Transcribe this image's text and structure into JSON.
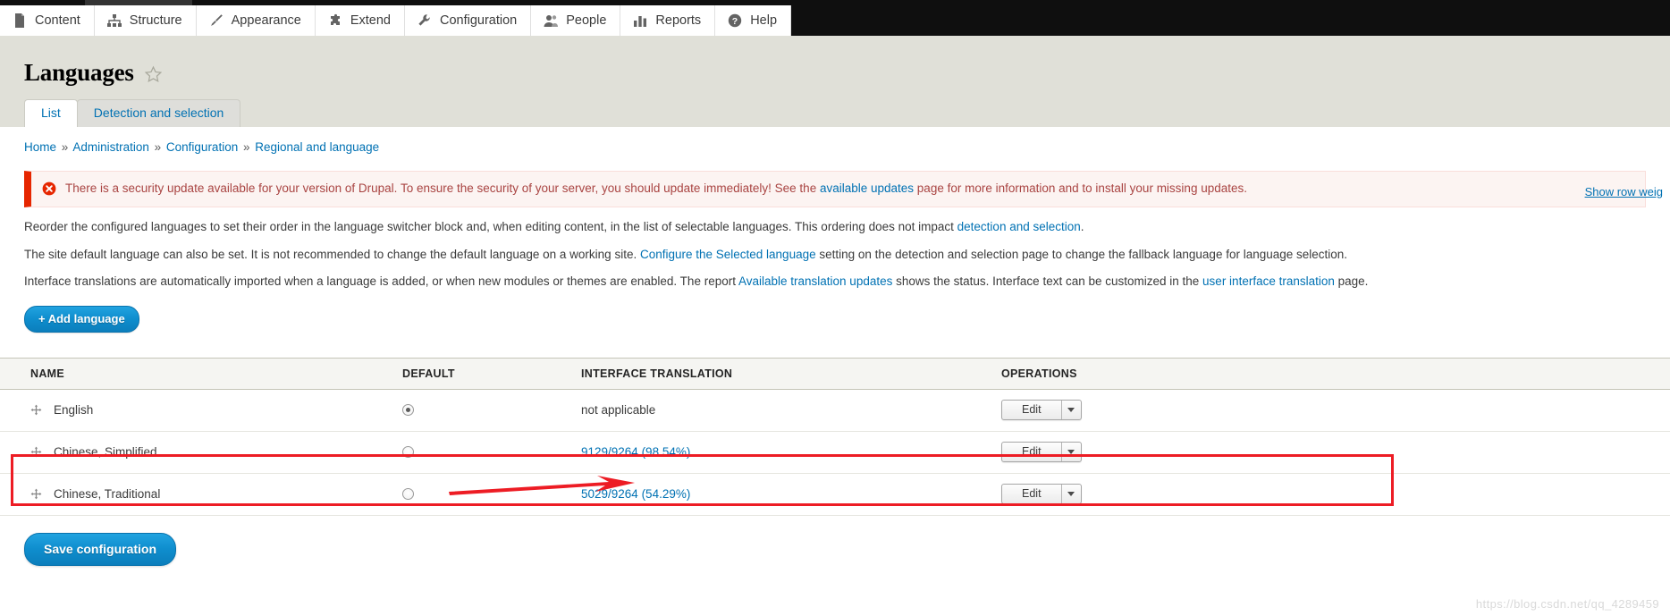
{
  "toolbar": {
    "items": [
      {
        "label": "Content",
        "icon": "file-icon"
      },
      {
        "label": "Structure",
        "icon": "structure-icon"
      },
      {
        "label": "Appearance",
        "icon": "paintbrush-icon"
      },
      {
        "label": "Extend",
        "icon": "puzzle-icon"
      },
      {
        "label": "Configuration",
        "icon": "wrench-icon"
      },
      {
        "label": "People",
        "icon": "people-icon"
      },
      {
        "label": "Reports",
        "icon": "bar-chart-icon"
      },
      {
        "label": "Help",
        "icon": "question-mark-icon"
      }
    ]
  },
  "header": {
    "title": "Languages",
    "favorite_icon": "star-outline-icon"
  },
  "tabs": [
    {
      "label": "List",
      "active": true
    },
    {
      "label": "Detection and selection",
      "active": false
    }
  ],
  "breadcrumb": {
    "separator": "»",
    "items": [
      "Home",
      "Administration",
      "Configuration",
      "Regional and language"
    ]
  },
  "error_message": {
    "icon": "error-circle-x-icon",
    "text_before_link": "There is a security update available for your version of Drupal. To ensure the security of your server, you should update immediately! See the ",
    "link_text": "available updates",
    "text_after_link": " page for more information and to install your missing updates."
  },
  "paragraphs": [
    {
      "before": "Reorder the configured languages to set their order in the language switcher block and, when editing content, in the list of selectable languages. This ordering does not impact ",
      "link": "detection and selection",
      "after": "."
    },
    {
      "before": "The site default language can also be set. It is not recommended to change the default language on a working site. ",
      "link": "Configure the Selected language",
      "after": " setting on the detection and selection page to change the fallback language for language selection."
    },
    {
      "before": "Interface translations are automatically imported when a language is added, or when new modules or themes are enabled. The report ",
      "link": "Available translation updates",
      "after": " shows the status. Interface text can be customized in the ",
      "link2": "user interface translation",
      "after2": " page."
    }
  ],
  "actions": {
    "add_language_label": "+ Add language",
    "save_label": "Save configuration",
    "show_row_weights_label": "Show row weig"
  },
  "table": {
    "columns": [
      "NAME",
      "DEFAULT",
      "INTERFACE TRANSLATION",
      "OPERATIONS"
    ],
    "rows": [
      {
        "name": "English",
        "default_selected": true,
        "translation": "not applicable",
        "translation_is_link": false,
        "operation_label": "Edit",
        "highlighted": false
      },
      {
        "name": "Chinese, Simplified",
        "default_selected": false,
        "translation": "9129/9264 (98.54%)",
        "translation_is_link": true,
        "operation_label": "Edit",
        "highlighted": true
      },
      {
        "name": "Chinese, Traditional",
        "default_selected": false,
        "translation": "5029/9264 (54.29%)",
        "translation_is_link": true,
        "operation_label": "Edit",
        "highlighted": false
      }
    ]
  },
  "annotations": {
    "highlight_color": "#ed1c24",
    "arrow_target": "9129/9264 (98.54%)"
  },
  "watermark": "https://blog.csdn.net/qq_4289459",
  "colors": {
    "accent_blue": "#0071b3",
    "button_blue": "#0f8ece",
    "error_red": "#e62600",
    "toolbar_dark": "#0f0f0f",
    "header_grey": "#e0e0d8"
  }
}
